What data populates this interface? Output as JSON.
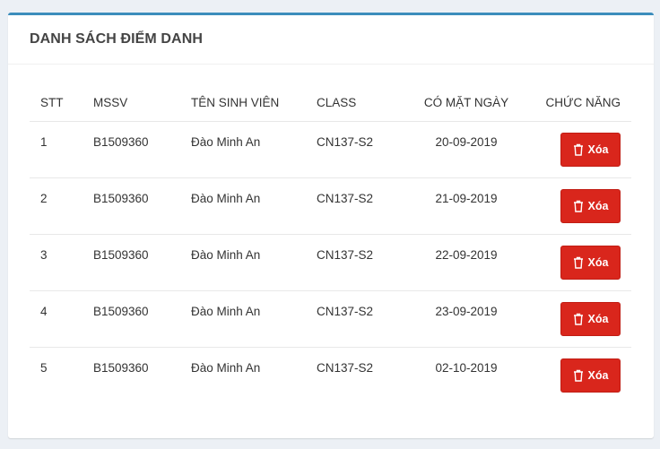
{
  "panel": {
    "title": "DANH SÁCH ĐIỂM DANH"
  },
  "table": {
    "headers": {
      "stt": "STT",
      "mssv": "MSSV",
      "name": "TÊN SINH VIÊN",
      "class": "CLASS",
      "date": "CÓ MẶT NGÀY",
      "action": "CHỨC NĂNG"
    },
    "rows": [
      {
        "stt": "1",
        "mssv": "B1509360",
        "name": "Đào Minh An",
        "class": "CN137-S2",
        "date": "20-09-2019",
        "action": "Xóa"
      },
      {
        "stt": "2",
        "mssv": "B1509360",
        "name": "Đào Minh An",
        "class": "CN137-S2",
        "date": "21-09-2019",
        "action": "Xóa"
      },
      {
        "stt": "3",
        "mssv": "B1509360",
        "name": "Đào Minh An",
        "class": "CN137-S2",
        "date": "22-09-2019",
        "action": "Xóa"
      },
      {
        "stt": "4",
        "mssv": "B1509360",
        "name": "Đào Minh An",
        "class": "CN137-S2",
        "date": "23-09-2019",
        "action": "Xóa"
      },
      {
        "stt": "5",
        "mssv": "B1509360",
        "name": "Đào Minh An",
        "class": "CN137-S2",
        "date": "02-10-2019",
        "action": "Xóa"
      }
    ]
  },
  "colors": {
    "accent": "#3c8dbc",
    "danger": "#d9261c",
    "background": "#ecf0f5"
  },
  "icons": {
    "delete": "trash-icon"
  }
}
